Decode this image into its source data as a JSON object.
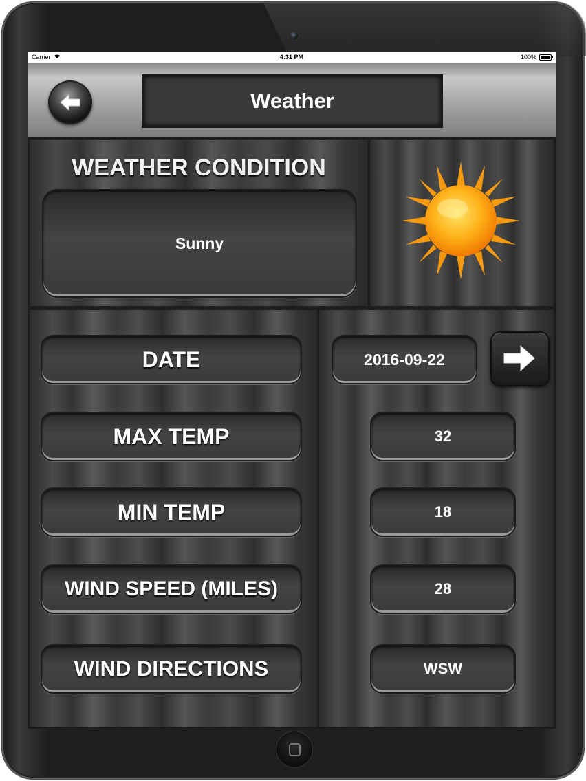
{
  "status_bar": {
    "carrier": "Carrier",
    "time": "4:31 PM",
    "battery": "100%"
  },
  "header": {
    "title": "Weather",
    "back_icon": "left-arrow-icon"
  },
  "condition": {
    "heading": "WEATHER CONDITION",
    "value": "Sunny",
    "icon": "sun-icon"
  },
  "fields": {
    "date_label": "DATE",
    "date_value": "2016-09-22",
    "max_temp_label": "MAX TEMP",
    "max_temp_value": "32",
    "min_temp_label": "MIN TEMP",
    "min_temp_value": "18",
    "wind_speed_label": "WIND SPEED (MILES)",
    "wind_speed_value": "28",
    "wind_dir_label": "WIND DIRECTIONS",
    "wind_dir_value": "WSW"
  }
}
